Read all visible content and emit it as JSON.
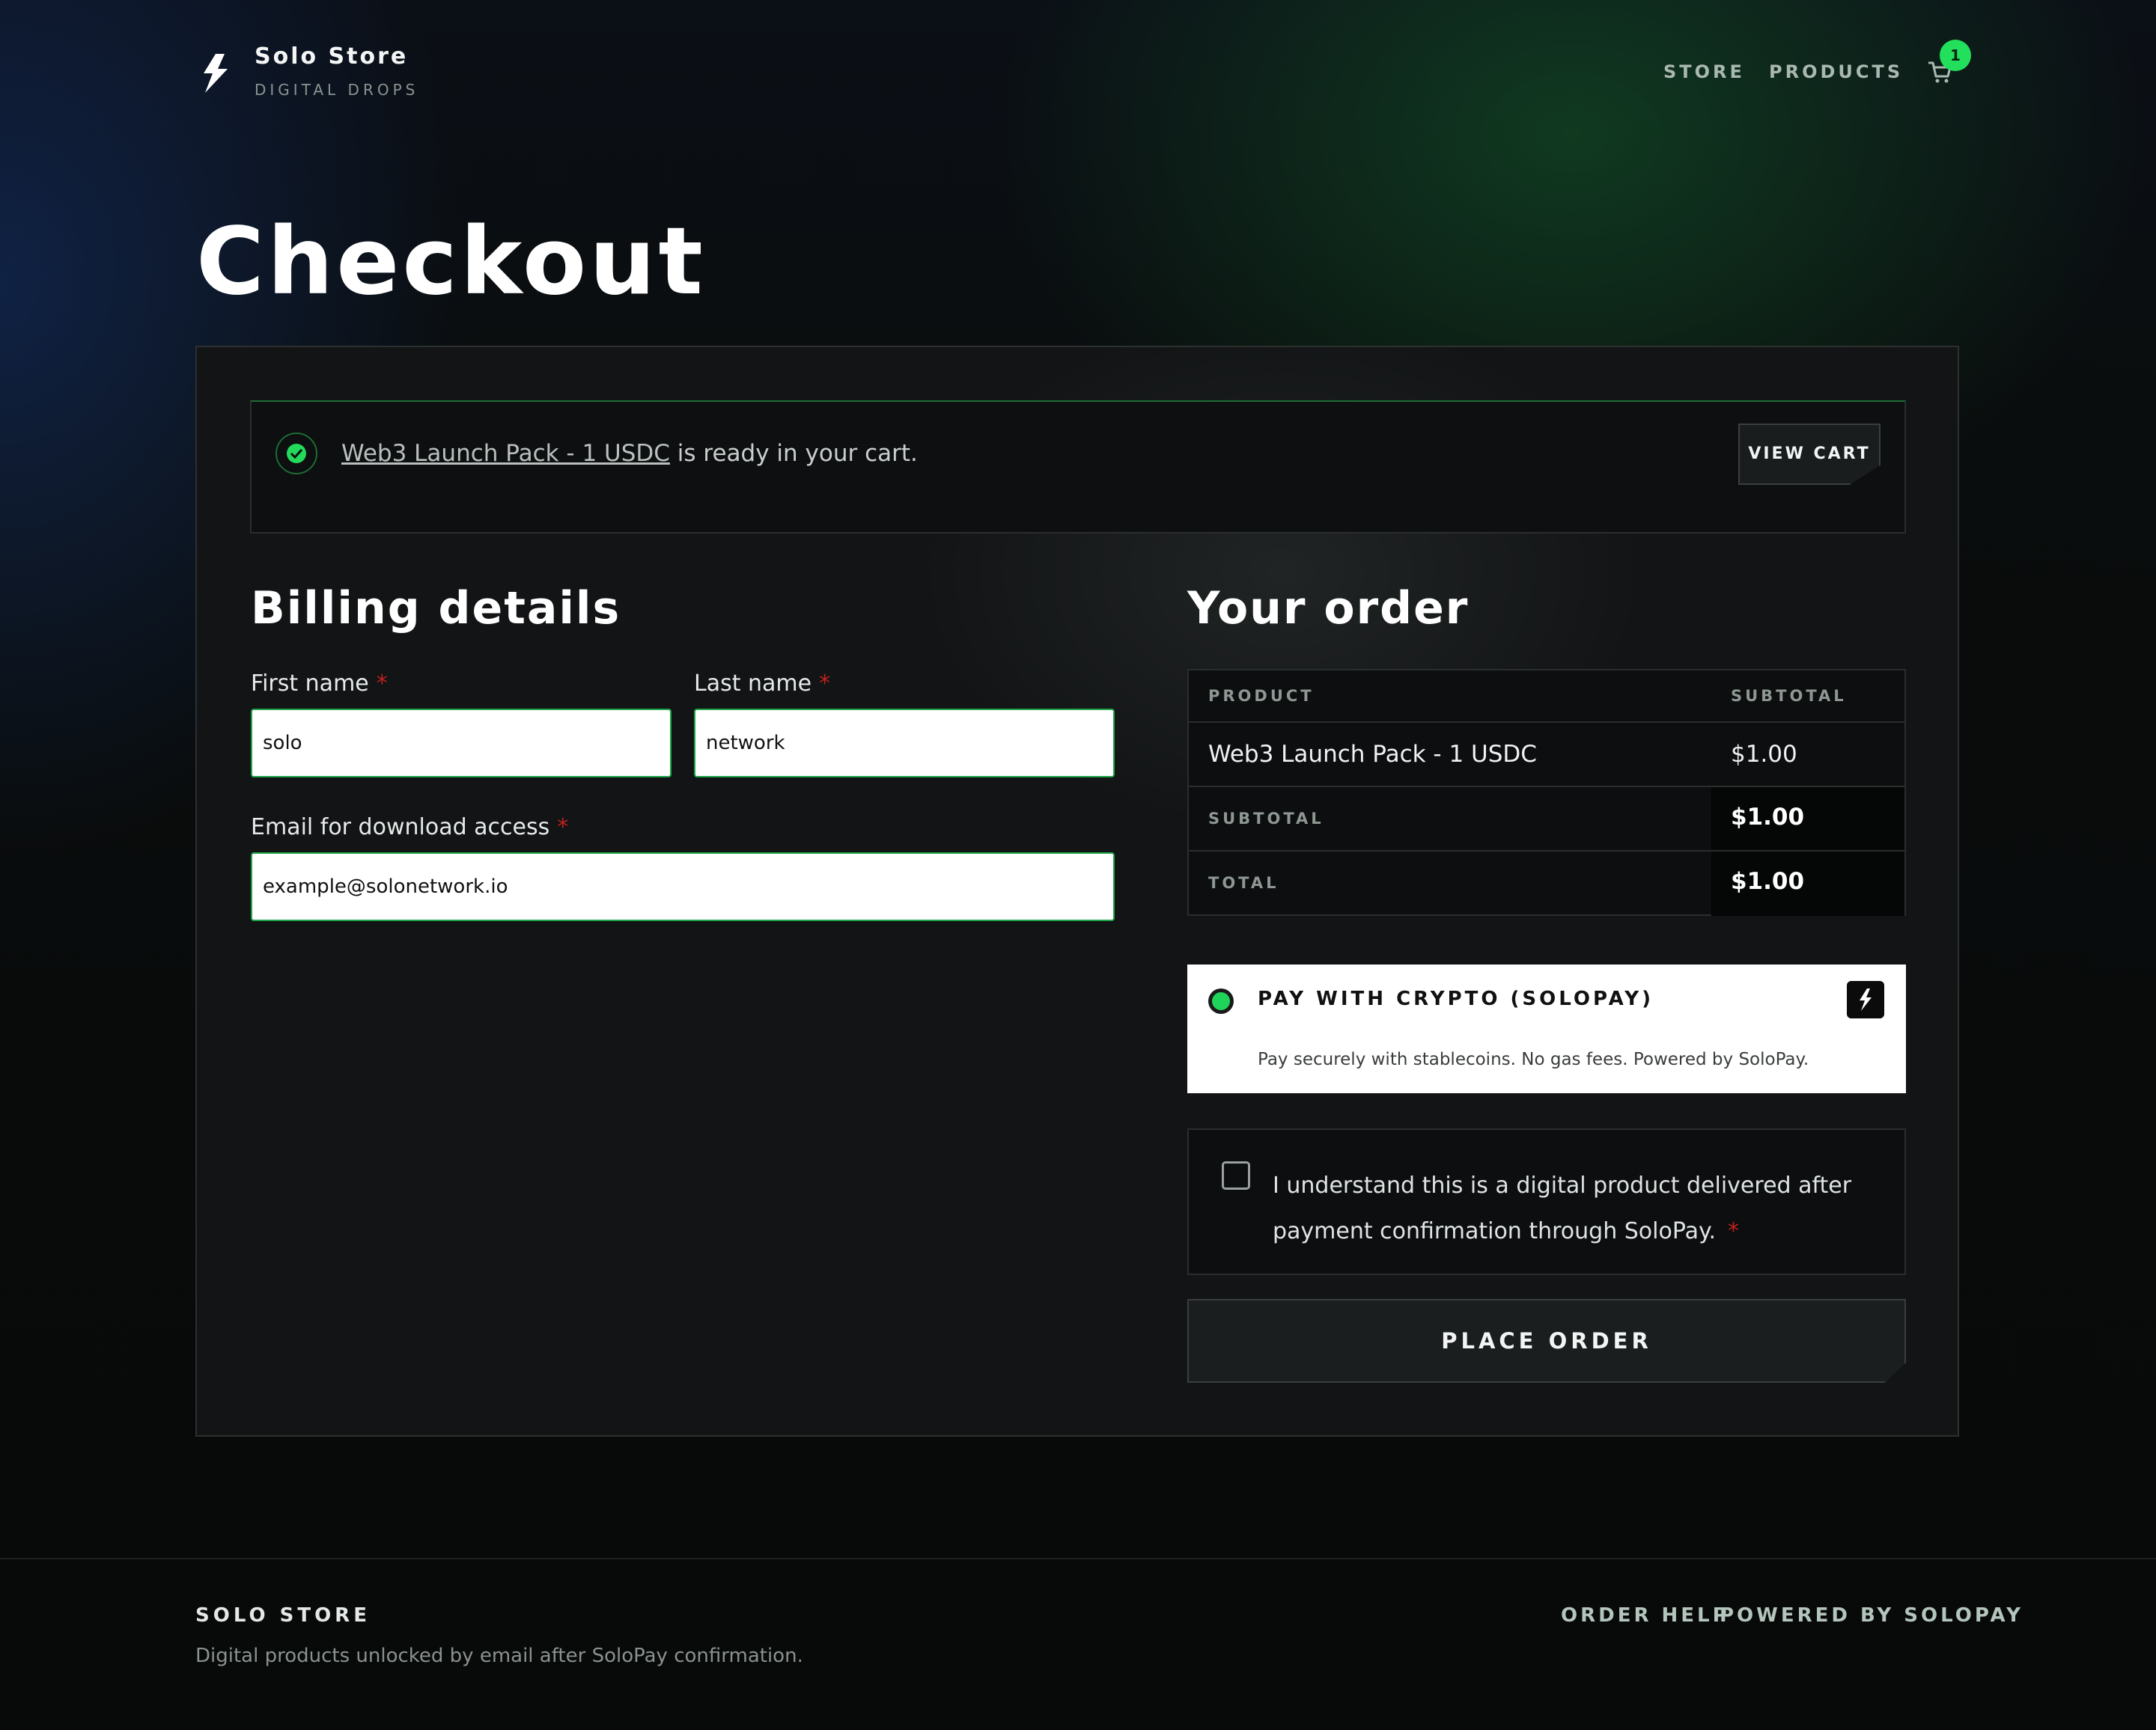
{
  "header": {
    "brand_name": "Solo Store",
    "brand_tagline": "DIGITAL DROPS",
    "nav": [
      "STORE",
      "PRODUCTS"
    ],
    "cart_count": "1",
    "accent_color": "#22e05c"
  },
  "page_title": "Checkout",
  "notice": {
    "product_link": "Web3 Launch Pack - 1 USDC",
    "message": " is ready in your cart.",
    "view_cart_label": "VIEW CART"
  },
  "billing": {
    "title": "Billing details",
    "first_name_label": "First name",
    "first_name_value": "solo",
    "last_name_label": "Last name",
    "last_name_value": "network",
    "email_label": "Email for download access",
    "email_value": "example@solonetwork.io",
    "required_marker": "*"
  },
  "order": {
    "title": "Your order",
    "col_product": "PRODUCT",
    "col_subtotal": "SUBTOTAL",
    "items": [
      {
        "name": "Web3 Launch Pack - 1 USDC",
        "price": "$1.00"
      }
    ],
    "subtotal_label": "SUBTOTAL",
    "subtotal_value": "$1.00",
    "total_label": "TOTAL",
    "total_value": "$1.00"
  },
  "payment": {
    "method_title": "PAY WITH CRYPTO (SOLOPAY)",
    "description": "Pay securely with stablecoins. No gas fees. Powered by SoloPay.",
    "selected": true
  },
  "agreement": {
    "text": "I understand this is a digital product delivered after payment confirmation through SoloPay.",
    "checked": false
  },
  "place_order_label": "PLACE ORDER",
  "footer": {
    "brand": "SOLO STORE",
    "description": "Digital products unlocked by email after SoloPay confirmation.",
    "links": [
      "ORDER HELP",
      "POWERED BY SOLOPAY"
    ]
  }
}
